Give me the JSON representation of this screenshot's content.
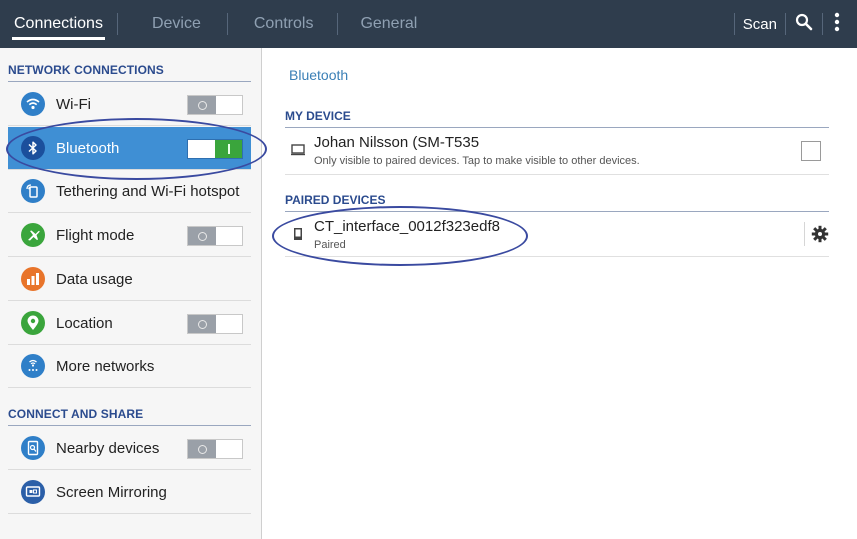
{
  "topbar": {
    "tabs": [
      {
        "label": "Connections",
        "active": true
      },
      {
        "label": "Device",
        "active": false
      },
      {
        "label": "Controls",
        "active": false
      },
      {
        "label": "General",
        "active": false
      }
    ],
    "scan_label": "Scan",
    "search_icon": "search-icon",
    "overflow_icon": "overflow-menu-icon"
  },
  "left": {
    "network_header": "NETWORK CONNECTIONS",
    "share_header": "CONNECT AND SHARE",
    "items": [
      {
        "label": "Wi-Fi",
        "icon": "wifi-icon",
        "color": "#2f7fc8",
        "toggle": "off"
      },
      {
        "label": "Bluetooth",
        "icon": "bluetooth-icon",
        "color": "#1b4f9c",
        "toggle": "on"
      },
      {
        "label": "Tethering and Wi-Fi hotspot",
        "icon": "tethering-icon",
        "color": "#2f7fc8"
      },
      {
        "label": "Flight mode",
        "icon": "airplane-icon",
        "color": "#3aa53c",
        "toggle": "off"
      },
      {
        "label": "Data usage",
        "icon": "data-usage-icon",
        "color": "#e8742a"
      },
      {
        "label": "Location",
        "icon": "location-icon",
        "color": "#3aa53c",
        "toggle": "off"
      },
      {
        "label": "More networks",
        "icon": "more-networks-icon",
        "color": "#2f7fc8"
      },
      {
        "label": "Nearby devices",
        "icon": "nearby-devices-icon",
        "color": "#2f7fc8",
        "toggle": "off"
      },
      {
        "label": "Screen Mirroring",
        "icon": "screen-mirroring-icon",
        "color": "#2b5fa8"
      }
    ]
  },
  "right": {
    "breadcrumb": "Bluetooth",
    "my_device_header": "MY DEVICE",
    "my_device_name": "Johan Nilsson (SM-T535",
    "my_device_sub": "Only visible to paired devices. Tap to make visible to other devices.",
    "paired_header": "PAIRED DEVICES",
    "paired_name": "CT_interface_0012f323edf8",
    "paired_status": "Paired"
  },
  "colors": {
    "topbar": "#2f3d4d",
    "selected": "#3f8fd4",
    "header_text": "#2b4b8e",
    "toggle_on": "#3aa53c",
    "annotation": "#3a4aa0"
  }
}
